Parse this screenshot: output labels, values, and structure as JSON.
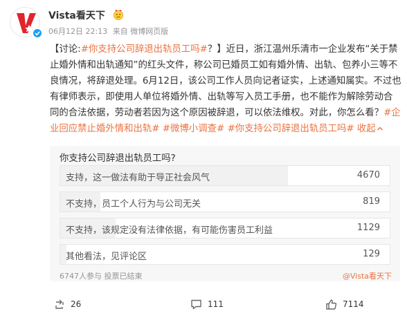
{
  "header": {
    "user_name": "Vista看天下",
    "timestamp": "06月12日 22:13",
    "source": "来自 微博网页版"
  },
  "post": {
    "topic_tag": "#你支持公司辞退出轨员工吗#",
    "segments": [
      "【讨论:",
      "？】近日，浙江温州乐清市一企业发布“关于禁止婚外情和出轨通知”的红头文件，称公司已婚员工如有婚外情、出轨、包养小三等不良情况，将辞退处理。6月12日，该公司工作人员向记者证实，上述通知属实。不过也有律师表示，即使用人单位将婚外情、出轨等写入员工手册，也不能作为解除劳动合同的合法依据，劳动者若因为这个原因被辞退，可以依法维权。对此，你怎么看？"
    ],
    "tags": [
      "#企业回应禁止婚外情和出轨#",
      "#微博小调查#",
      "#你支持公司辞退出轨员工吗#"
    ],
    "collapse_label": "收起"
  },
  "poll": {
    "question": "你支持公司辞退出轨员工吗?",
    "options": [
      {
        "label": "支持，这一做法有助于导正社会风气",
        "count": 4670,
        "count_text": "4670"
      },
      {
        "label": "不支持，员工个人行为与公司无关",
        "count": 819,
        "count_text": "819"
      },
      {
        "label": "不支持，该规定没有法律依据，有可能伤害员工利益",
        "count": 1129,
        "count_text": "1129"
      },
      {
        "label": "其他看法，见评论区",
        "count": 129,
        "count_text": "129"
      }
    ],
    "participants_text": "6747人参与 投票已结束",
    "author_text": "@Vista看天下"
  },
  "actions": {
    "repost_count": "26",
    "comment_count": "111",
    "like_count": "7114"
  },
  "colors": {
    "accent": "#eb7340",
    "brand_red": "#e1252c",
    "verified_blue": "#1da1f2"
  },
  "icons": {
    "repost": "repost-icon",
    "comment": "comment-icon",
    "like": "thumbs-up-icon",
    "verified": "verified-icon",
    "badge": "emoji-badge-icon",
    "collapse": "chevron-up-icon"
  }
}
